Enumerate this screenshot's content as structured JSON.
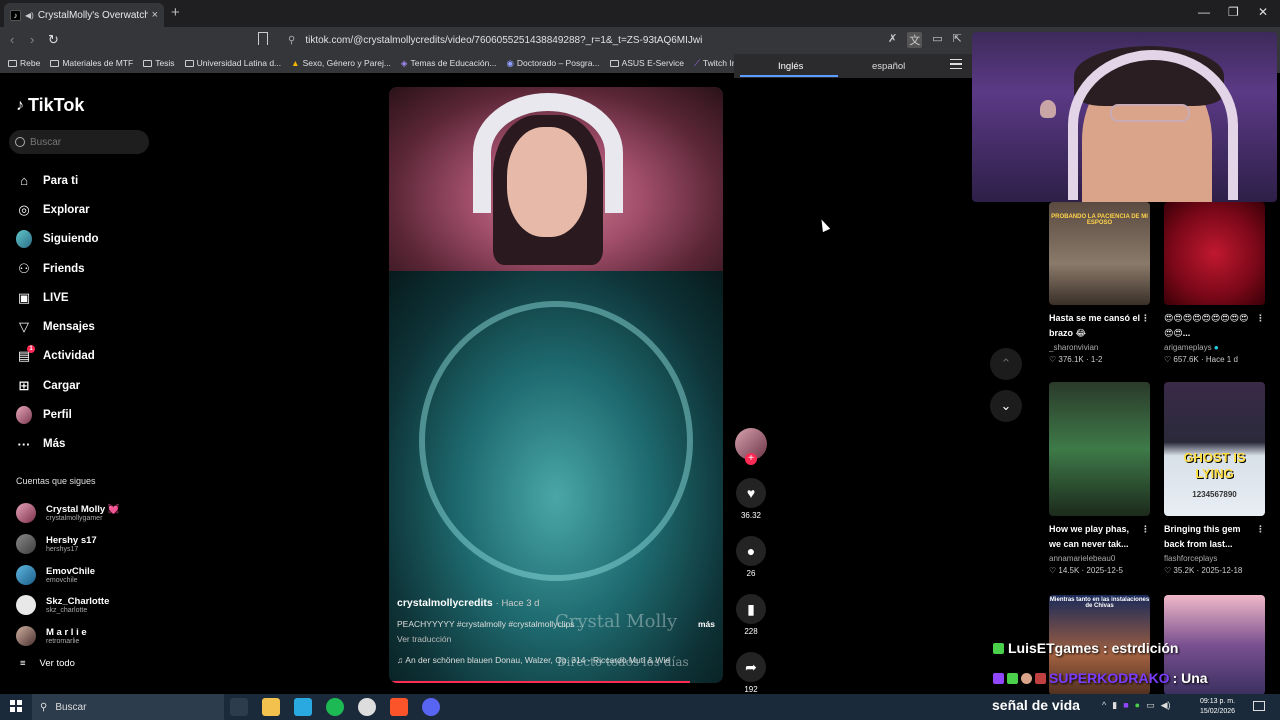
{
  "browser": {
    "tab_title": "CrystalMolly's Overwatch Hig",
    "tab_close": "×",
    "new_tab": "+",
    "url": "tiktok.com/@crystalmollycredits/video/7606055251438849288?_r=1&_t=ZS-93tAQ6MIJwi",
    "window_controls": [
      "—",
      "❐",
      "✕"
    ],
    "bookmarks": [
      "Rebe",
      "Materiales de MTF",
      "Tesis",
      "Universidad Latina d...",
      "Sexo, Género y Parej...",
      "Temas de Educación...",
      "Doctorado – Posgra...",
      "ASUS E-Service",
      "Twitch Insi"
    ]
  },
  "translate": {
    "source_lang": "Inglés",
    "target_lang": "español"
  },
  "sidebar": {
    "logo": "TikTok",
    "search_placeholder": "Buscar",
    "nav": [
      {
        "label": "Para ti",
        "icon": "home-icon"
      },
      {
        "label": "Explorar",
        "icon": "compass-icon"
      },
      {
        "label": "Siguiendo",
        "icon": "following-avatar-icon"
      },
      {
        "label": "Friends",
        "icon": "friends-icon"
      },
      {
        "label": "LIVE",
        "icon": "live-icon"
      },
      {
        "label": "Mensajes",
        "icon": "messages-icon"
      },
      {
        "label": "Actividad",
        "icon": "activity-icon",
        "badge": "1"
      },
      {
        "label": "Cargar",
        "icon": "upload-icon"
      },
      {
        "label": "Perfil",
        "icon": "profile-avatar-icon"
      },
      {
        "label": "Más",
        "icon": "more-icon"
      }
    ],
    "following_title": "Cuentas que sigues",
    "following": [
      {
        "name": "Crystal Molly 💓",
        "handle": "crystalmollygamer"
      },
      {
        "name": "Hershy s17",
        "handle": "hershys17"
      },
      {
        "name": "EmovChile",
        "handle": "emovchile"
      },
      {
        "name": "Skz_Charlotte",
        "handle": "skz_charlotte"
      },
      {
        "name": "M a r l i e",
        "handle": "retromarlie"
      }
    ],
    "see_all": "Ver todo"
  },
  "video": {
    "overlay_title": "Crystal Molly",
    "overlay_sub": "Directo todos los días",
    "username": "crystalmollycredits",
    "posted": "· Hace 3 d",
    "description": "PEACHYYYYY #crystalmolly #crystalmollyclips ...",
    "more": "más",
    "see_translation": "Ver traducción",
    "music": "An der schönen blauen Donau, Walzer, Op. 314 - Riccardo Muti & Wie",
    "progress": 0.9
  },
  "actions": {
    "likes": "36.32",
    "comments": "26",
    "saves": "228",
    "shares": "192"
  },
  "recommended": [
    {
      "title": "Hasta se me cansó el brazo 😂",
      "user": "_sharonvivian",
      "views": "376.1K",
      "date": "1-2",
      "thumb_label": "PROBANDO LA PACIENCIA DE MI ESPOSO"
    },
    {
      "title": "😍😍😍😍😍😍😍😍😍😍😍...",
      "user": "arigameplays",
      "views": "657.6K",
      "date": "Hace 1 d"
    },
    {
      "title": "How we play phas, we can never tak...",
      "user": "annamarielebeau0",
      "views": "14.5K",
      "date": "2025-12-5"
    },
    {
      "title": "Bringing this gem back from last...",
      "user": "flashforceplays",
      "views": "35.2K",
      "date": "2025-12-18",
      "thumb_label": "GHOST IS LYING",
      "thumb_sub": "1234567890"
    },
    {
      "title": "",
      "user": "",
      "views": "",
      "date": "",
      "thumb_label": "Mientras tanto en las instalaciones de Chivas"
    },
    {
      "title": "",
      "user": "",
      "views": "",
      "date": ""
    }
  ],
  "chat": {
    "line1_user": "LuisETgames",
    "line1_text": ": estrdición",
    "line2_user": "SUPERKODRAKO",
    "line2_text": ": Una",
    "line3": "señal de vida"
  },
  "taskbar": {
    "search": "Buscar",
    "time": "09:13 p. m.",
    "date": "15/02/2026"
  }
}
